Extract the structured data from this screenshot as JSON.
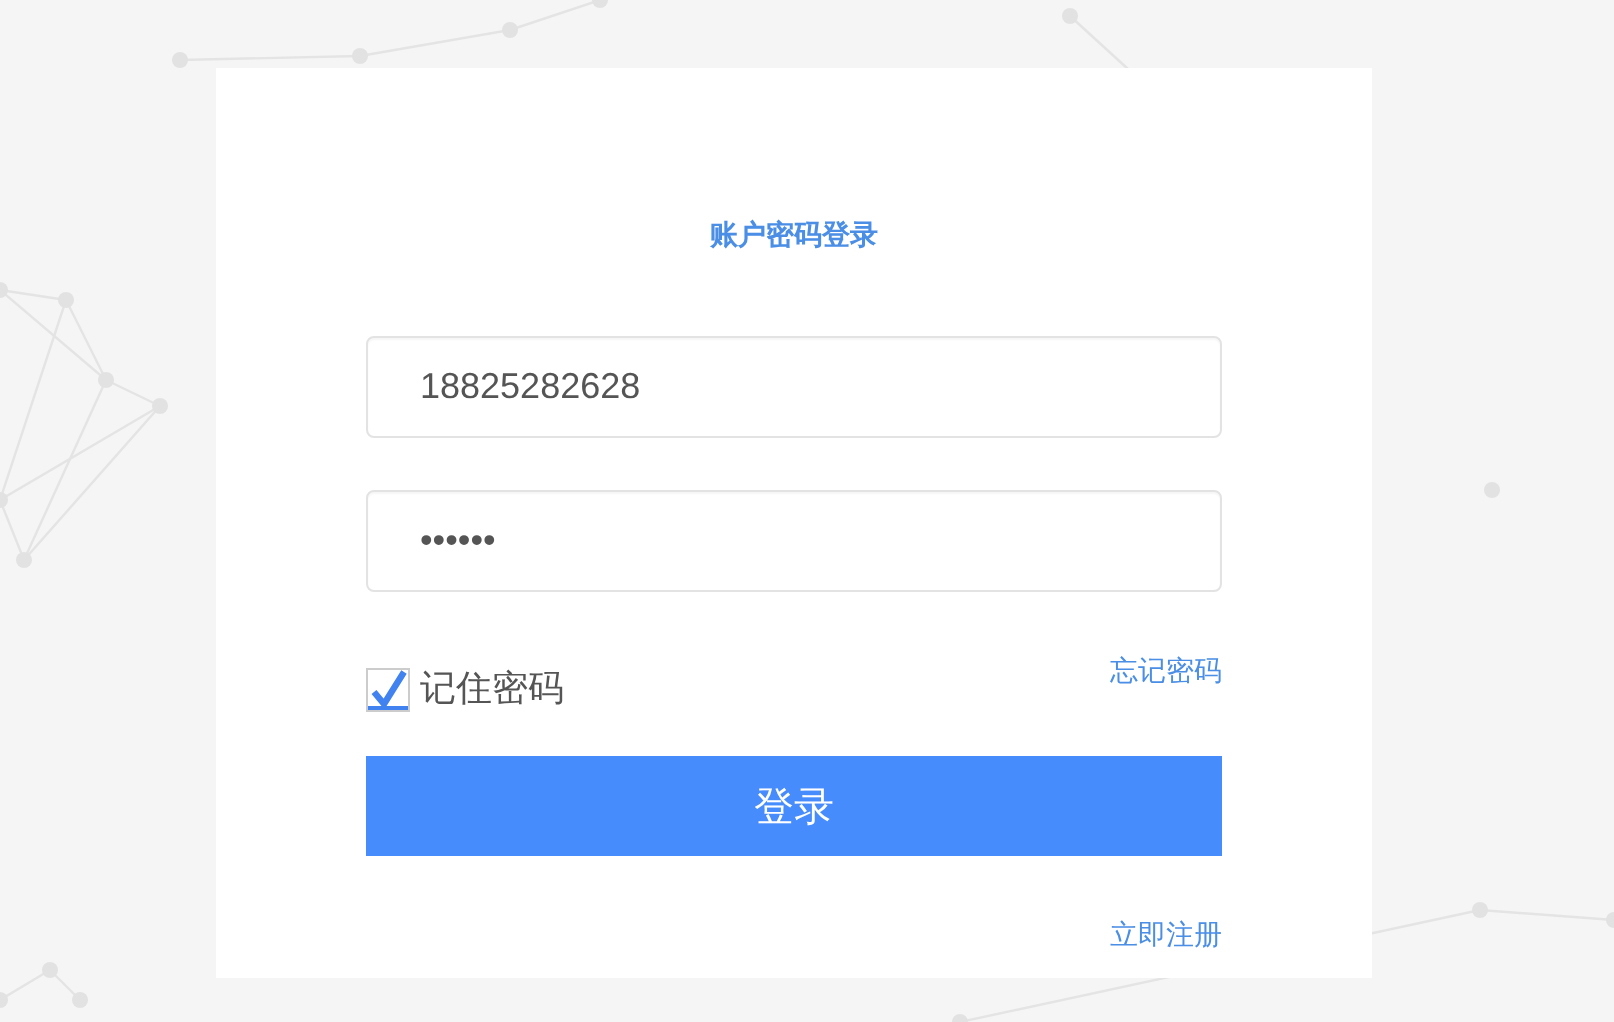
{
  "login_card": {
    "title": "账户密码登录",
    "phone_field": {
      "value": "18825282628"
    },
    "password_field": {
      "value": "••••••"
    },
    "remember": {
      "label": "记住密码",
      "checked": true
    },
    "forgot_link": "忘记密码",
    "login_button": "登录",
    "register_link": "立即注册"
  }
}
